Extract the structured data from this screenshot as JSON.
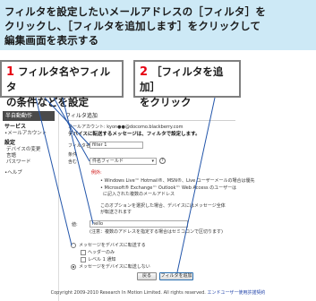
{
  "banner": {
    "line1": "フィルタを設定したいメールアドレスの［フィルタ］を",
    "line2": "クリックし、［フィルタを追加します］をクリックして",
    "line3": "編集画面を表示する"
  },
  "callouts": [
    {
      "num": "1",
      "line1": "フィルタ名やフィルタ",
      "line2": "の条件などを設定"
    },
    {
      "num": "2",
      "line1": "［フィルタを追加］",
      "line2": "をクリック"
    }
  ],
  "sidebar": {
    "title": "半自動動作",
    "service_label": "サービス",
    "email_account": "•メールアカウント",
    "settings_label": "設定",
    "items": [
      "デバイスの変更",
      "言語",
      "パスワード"
    ],
    "help": "•ヘルプ"
  },
  "form": {
    "page_title": "フィルタ追加",
    "account_line": "メールアカウント: kyon●●@docomo.blackberry.com",
    "note": "デバイスに転送するメッセージは、フィルタで設定します。",
    "filter_name_label": "フィルタ名:",
    "filter_name_value": "filter 1",
    "condition_label": "条件",
    "condition_select": "件名フィールド",
    "contains_label": "含む",
    "example_label": "例外:",
    "bullets": [
      "Windows Live™ Hotmail®、MSN®、Live ユーザーメールの場合は優先",
      "Microsoft® Exchange™ Outlook™ Web Access のユーザーは",
      "に記入された複数のメールアドレス"
    ],
    "bullet_tail": "このオプションを選択した場合、デバイスにはメッセージ全体",
    "bullet_tail2": "が転送されます",
    "keyword_label": "値:",
    "keyword_value": "hello",
    "keyword_hint": "(注意：複数のアドレスを指定する場合はセミコロンで区切ります)",
    "radio1": "メッセージをデバイスに転送する",
    "sub_options": [
      "ヘッダーのみ",
      "レベル 1 通知"
    ],
    "radio2": "メッセージをデバイスに転送しない",
    "cancel_button": "戻る",
    "add_button": "フィルタを追加"
  },
  "footer": {
    "copyright": "Copyright 2009-2010 Research In Motion Limited. All rights reserved.",
    "links": "エンドユーザー使用許諾契約"
  },
  "colors": {
    "banner_bg": "#cde9f6",
    "callout_number": "#e60012",
    "pointer_line": "#2255aa"
  }
}
